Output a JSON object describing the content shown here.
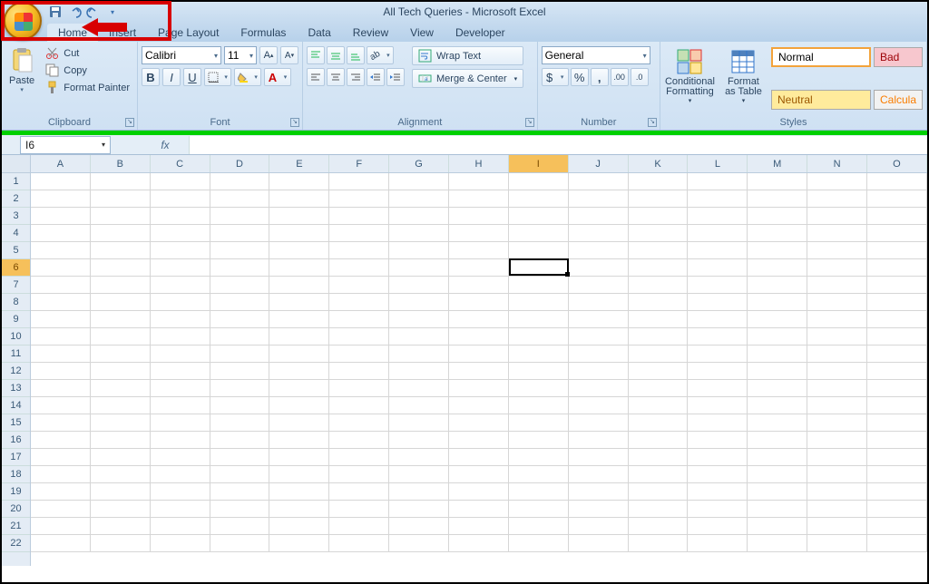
{
  "app_title": "All Tech Queries - Microsoft Excel",
  "qat": {
    "save": "save",
    "undo": "undo",
    "redo": "redo"
  },
  "tabs": [
    "Home",
    "Insert",
    "Page Layout",
    "Formulas",
    "Data",
    "Review",
    "View",
    "Developer"
  ],
  "active_tab": "Home",
  "clipboard": {
    "paste": "Paste",
    "cut": "Cut",
    "copy": "Copy",
    "format_painter": "Format Painter",
    "label": "Clipboard"
  },
  "font": {
    "name": "Calibri",
    "size": "11",
    "label": "Font"
  },
  "alignment": {
    "wrap": "Wrap Text",
    "merge": "Merge & Center",
    "label": "Alignment"
  },
  "number": {
    "format": "General",
    "label": "Number"
  },
  "cond_format": "Conditional Formatting",
  "format_table": "Format as Table",
  "styles": {
    "normal": "Normal",
    "bad": "Bad",
    "neutral": "Neutral",
    "calc": "Calcula",
    "label": "Styles"
  },
  "name_box": "I6",
  "columns": [
    "A",
    "B",
    "C",
    "D",
    "E",
    "F",
    "G",
    "H",
    "I",
    "J",
    "K",
    "L",
    "M",
    "N",
    "O"
  ],
  "rows": [
    "1",
    "2",
    "3",
    "4",
    "5",
    "6",
    "7",
    "8",
    "9",
    "10",
    "11",
    "12",
    "13",
    "14",
    "15",
    "16",
    "17",
    "18",
    "19",
    "20",
    "21",
    "22"
  ],
  "selected_col": "I",
  "selected_row": "6"
}
